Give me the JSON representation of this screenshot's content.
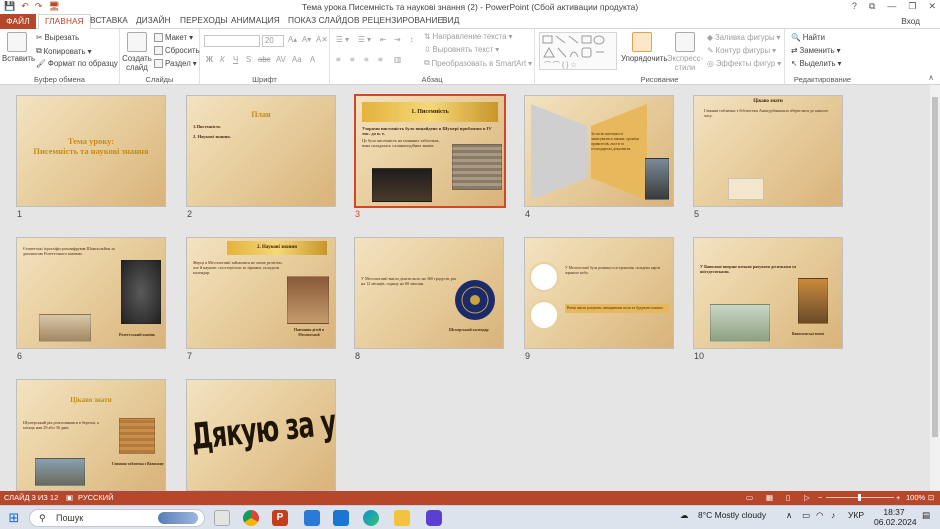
{
  "window": {
    "title": "Тема урока Писемність та наукові знання (2) - PowerPoint (Сбой активации продукта)",
    "controls": [
      "?",
      "⧉",
      "—",
      "❐",
      "✕"
    ],
    "sign_in": "Вход"
  },
  "quick_access": {
    "save": "💾",
    "undo": "↶",
    "redo": "↷",
    "start": "🖥"
  },
  "tabs": [
    {
      "id": "file",
      "label": "ФАЙЛ"
    },
    {
      "id": "home",
      "label": "ГЛАВНАЯ"
    },
    {
      "id": "insert",
      "label": "ВСТАВКА"
    },
    {
      "id": "design",
      "label": "ДИЗАЙН"
    },
    {
      "id": "transitions",
      "label": "ПЕРЕХОДЫ"
    },
    {
      "id": "animations",
      "label": "АНИМАЦИЯ"
    },
    {
      "id": "slideshow",
      "label": "ПОКАЗ СЛАЙДОВ"
    },
    {
      "id": "review",
      "label": "РЕЦЕНЗИРОВАНИЕ"
    },
    {
      "id": "view",
      "label": "ВИД"
    }
  ],
  "ribbon": {
    "clipboard": {
      "paste": "Вставить",
      "cut": "Вырезать",
      "copy": "Копировать",
      "format_painter": "Формат по образцу",
      "label": "Буфер обмена"
    },
    "slides": {
      "new_slide": "Создать слайд",
      "layout": "Макет",
      "reset": "Сбросить",
      "section": "Раздел",
      "label": "Слайды"
    },
    "font": {
      "font_name": "",
      "font_size": "20",
      "bold": "Ж",
      "italic": "К",
      "underline": "Ч",
      "strike": "S",
      "abc": "abc",
      "spacing": "AV",
      "case": "Aa",
      "color": "A",
      "grow": "A▴",
      "shrink": "A▾",
      "clear": "A✕",
      "label": "Шрифт"
    },
    "paragraph": {
      "text_direction": "Направление текста",
      "align_text": "Выровнять текст",
      "smartart": "Преобразовать в SmartArt",
      "label": "Абзац"
    },
    "drawing": {
      "arrange": "Упорядочить",
      "quick_styles": "Экспресс-стили",
      "fill": "Заливка фигуры",
      "outline": "Контур фигуры",
      "effects": "Эффекты фигур",
      "label": "Рисование"
    },
    "editing": {
      "find": "Найти",
      "replace": "Заменить",
      "select": "Выделить",
      "label": "Редактирование"
    }
  },
  "slides": [
    {
      "n": "1",
      "title": "Тема уроку:\nПисемність та наукові знання"
    },
    {
      "n": "2",
      "title": "План",
      "items": [
        "1.Писемність",
        "2. Наукові знання."
      ]
    },
    {
      "n": "3",
      "title": "1. Писемність",
      "text": "Узорами писемність було винайдено в Шумері приблизно в IV тис. до н. е.",
      "text2": "Це була писемність на глиняних табличках, вона складалась з клиноподібних знаків."
    },
    {
      "n": "4",
      "text": "За часів писемності записувались закони, хроніки правителів, листи та господарські документи."
    },
    {
      "n": "5",
      "title": "Цікаво знати",
      "text": "Глиняні таблички з бібліотеки Ашшурбанапала збереглися до нашого часу."
    },
    {
      "n": "6",
      "text": "Єгипетські ієрогліфи розшифрував Шампольйон за допомогою Розеттського каменю.",
      "caption": "Розеттський камінь"
    },
    {
      "n": "7",
      "title": "2. Наукові знання",
      "text": "Жерці в Месопотамії займалися не лише релігією, але й наукою: спостерігали за зірками, складали календар.",
      "caption": "Навчання дітей в Месопотамії"
    },
    {
      "n": "8",
      "text": "У Месопотамії вміли ділити коло на 360 градусів, рік на 12 місяців, годину на 60 хвилин.",
      "caption": "Шумерський календар"
    },
    {
      "n": "9",
      "text": "У Месопотамії була розвинута астрономія, складено карти зоряного неба.",
      "text2": "Вчені вміли рахувати, вимірювати поля та будувати канали."
    },
    {
      "n": "10",
      "text": "У Вавилоні вперше почали рахувати десятками та шістдесятками.",
      "caption": "Вавилонські вчені"
    },
    {
      "n": "11",
      "title": "Цікаво знати",
      "text": "Шумерський рік розпочинався в березні, а місяць мав 29 або 30 днів.",
      "caption": "Глиняна табличка з Вавилону"
    },
    {
      "n": "12",
      "title": "Дякую за увагу!"
    }
  ],
  "status": {
    "slide_info": "СЛАЙД 3 ИЗ 12",
    "language": "РУССКИЙ",
    "zoom": "100%",
    "zoom_fraction": 0.5
  },
  "taskbar": {
    "search_label": "Пошук",
    "weather": "8°C  Mostly cloudy",
    "lang": "УКР",
    "time": "18:37",
    "date": "06.02.2024",
    "apps": [
      "task-view",
      "chrome",
      "powerpoint",
      "store",
      "mail",
      "edge",
      "explorer",
      "phone"
    ]
  },
  "colors": {
    "accent": "#b7472a",
    "selected_border": "#d24726",
    "slide_title": "#c78a16"
  }
}
